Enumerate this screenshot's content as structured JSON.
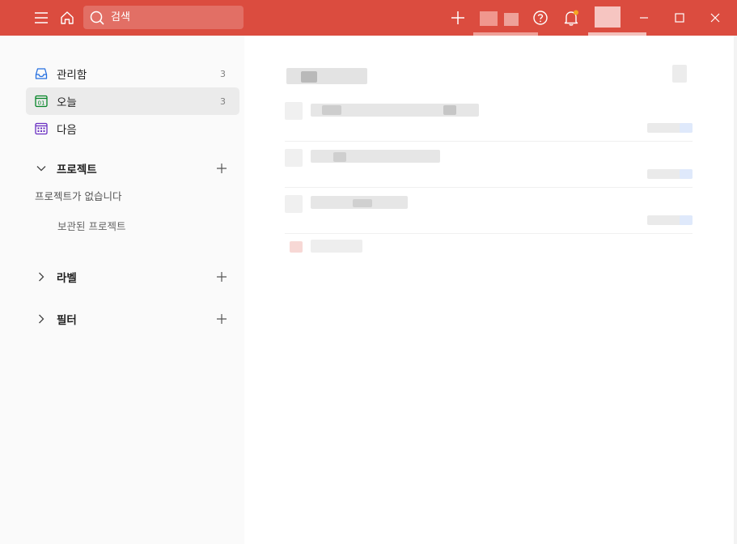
{
  "topbar": {
    "search_placeholder": "검색",
    "accent": "#db4c3f"
  },
  "sidebar": {
    "items": [
      {
        "label": "관리함",
        "count": "3",
        "icon": "inbox-icon"
      },
      {
        "label": "오늘",
        "count": "3",
        "icon": "calendar-today-icon"
      },
      {
        "label": "다음",
        "count": "",
        "icon": "calendar-upcoming-icon"
      }
    ],
    "projects": {
      "title": "프로젝트",
      "empty_text": "프로젝트가 없습니다",
      "archived_label": "보관된 프로젝트"
    },
    "labels_title": "라벨",
    "filters_title": "필터"
  }
}
